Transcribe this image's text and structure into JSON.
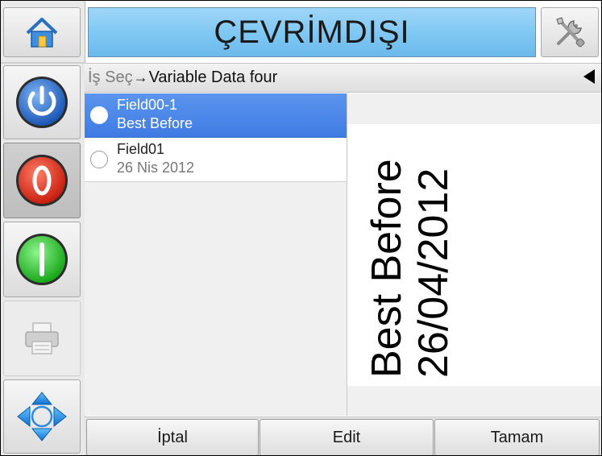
{
  "header": {
    "title": "ÇEVRİMDIŞI",
    "home_icon": "home-icon",
    "tools_icon": "tools-icon",
    "title_color": "#7ec7f3"
  },
  "rail": {
    "buttons": [
      {
        "name": "power-button",
        "icon": "power-icon",
        "color": "#2b6ec9"
      },
      {
        "name": "stop-button",
        "icon": "stop-icon",
        "color": "#e2311d"
      },
      {
        "name": "start-button",
        "icon": "start-icon",
        "color": "#2ecc2e"
      },
      {
        "name": "print-button",
        "icon": "printer-icon"
      },
      {
        "name": "navigation-button",
        "icon": "move-arrows-icon",
        "color": "#1e8fe0"
      }
    ]
  },
  "breadcrumb": {
    "first": "İş Seç",
    "separator": "→",
    "current": "Variable Data four"
  },
  "fields": [
    {
      "name": "Field00-1",
      "value": "Best Before",
      "selected": true
    },
    {
      "name": "Field01",
      "value": "26 Nis 2012",
      "selected": false
    }
  ],
  "preview": {
    "line1": "Best Before",
    "line2": "26/04/2012"
  },
  "actions": {
    "cancel": "İptal",
    "edit": "Edit",
    "ok": "Tamam"
  }
}
